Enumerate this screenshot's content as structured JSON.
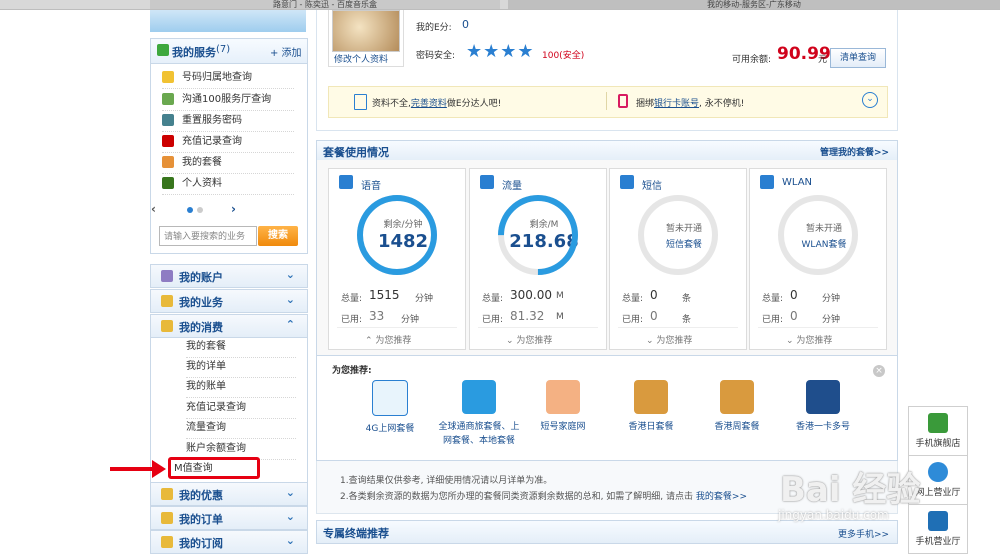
{
  "browser": {
    "tab1": "路意门 - 陈奕迅 - 百度音乐盒",
    "tab2": "我的移动-服务区-广东移动"
  },
  "profile": {
    "edit_label": "修改个人资料",
    "e_points_label": "我的E分:",
    "e_points_value": "0",
    "security_label": "密码安全:",
    "security_value": "100(安全)",
    "stars": 4,
    "balance_label": "可用余额:",
    "balance_value": "90.99",
    "balance_unit": "元",
    "query_button": "清单查询",
    "notice1_prefix": "资料不全,",
    "notice1_link": "完善资料",
    "notice1_suffix": "做E分达人吧!",
    "notice2_prefix": "捆绑",
    "notice2_link": "银行卡账号",
    "notice2_suffix": ", 永不停机!"
  },
  "services": {
    "title": "我的服务",
    "count": "(7)",
    "add_label": "+ 添加",
    "items": [
      {
        "label": "号码归属地查询"
      },
      {
        "label": "沟通100服务厅查询"
      },
      {
        "label": "重置服务密码"
      },
      {
        "label": "充值记录查询"
      },
      {
        "label": "我的套餐"
      },
      {
        "label": "个人资料"
      }
    ],
    "search_placeholder": "请输入要搜索的业务",
    "search_button": "搜索"
  },
  "menu": {
    "groups": [
      {
        "label": "我的账户"
      },
      {
        "label": "我的业务"
      },
      {
        "label": "我的消费"
      }
    ],
    "consume_items": [
      {
        "label": "我的套餐"
      },
      {
        "label": "我的详单"
      },
      {
        "label": "我的账单"
      },
      {
        "label": "充值记录查询"
      },
      {
        "label": "流量查询"
      },
      {
        "label": "账户余额查询"
      },
      {
        "label": "M值查询"
      }
    ],
    "after_groups": [
      {
        "label": "我的优惠"
      },
      {
        "label": "我的订单"
      },
      {
        "label": "我的订阅"
      }
    ]
  },
  "package": {
    "title": "套餐使用情况",
    "manage_link": "管理我的套餐>>",
    "cards": [
      {
        "title": "语音",
        "ring_sub": "剩余/分钟",
        "ring_value": "1482",
        "remaining_fraction": 0.98,
        "total_label": "总量:",
        "total_value": "1515",
        "total_unit": "分钟",
        "used_label": "已用:",
        "used_value": "33",
        "used_unit": "分钟",
        "rec_label": "为您推荐"
      },
      {
        "title": "流量",
        "ring_sub": "剩余/M",
        "ring_value": "218.68",
        "remaining_fraction": 0.73,
        "total_label": "总量:",
        "total_value": "300.00",
        "total_unit": "M",
        "used_label": "已用:",
        "used_value": "81.32",
        "used_unit": "M",
        "rec_label": "为您推荐"
      },
      {
        "title": "短信",
        "ring_txt1": "暂未开通",
        "ring_txt2": "短信套餐",
        "total_label": "总量:",
        "total_value": "0",
        "total_unit": "条",
        "used_label": "已用:",
        "used_value": "0",
        "used_unit": "条",
        "rec_label": "为您推荐"
      },
      {
        "title": "WLAN",
        "ring_txt1": "暂未开通",
        "ring_txt2": "WLAN套餐",
        "total_label": "总量:",
        "total_value": "0",
        "total_unit": "分钟",
        "used_label": "已用:",
        "used_value": "0",
        "used_unit": "分钟",
        "rec_label": "为您推荐"
      }
    ]
  },
  "recommend": {
    "title": "为您推荐:",
    "items": [
      {
        "line1": "4G上网套餐",
        "line2": ""
      },
      {
        "line1": "全球通商旅套餐、上",
        "line2": "网套餐、本地套餐"
      },
      {
        "line1": "短号家庭网",
        "line2": ""
      },
      {
        "line1": "香港日套餐",
        "line2": ""
      },
      {
        "line1": "香港周套餐",
        "line2": ""
      },
      {
        "line1": "香港一卡多号",
        "line2": ""
      }
    ]
  },
  "notes": {
    "note1": "1.查询结果仅供参考, 详细使用情况请以月详单为准。",
    "note2_prefix": "2.各类剩余资源的数据为您所办理的套餐同类资源剩余数据的总和, 如需了解明细, 请点击",
    "note2_link": "我的套餐>>"
  },
  "terminal": {
    "title": "专属终端推荐",
    "more_link": "更多手机>>"
  },
  "float": {
    "items": [
      {
        "label": "手机旗舰店"
      },
      {
        "label": "网上营业厅"
      },
      {
        "label": "手机营业厅"
      }
    ]
  },
  "watermark": {
    "text": "Bai 经验",
    "url": "jingyan.baidu.com"
  },
  "colors": {
    "brand_blue": "#1a4f8f",
    "accent_orange": "#f08a0c",
    "highlight_red": "#e60012",
    "balance_red": "#d0021b"
  }
}
